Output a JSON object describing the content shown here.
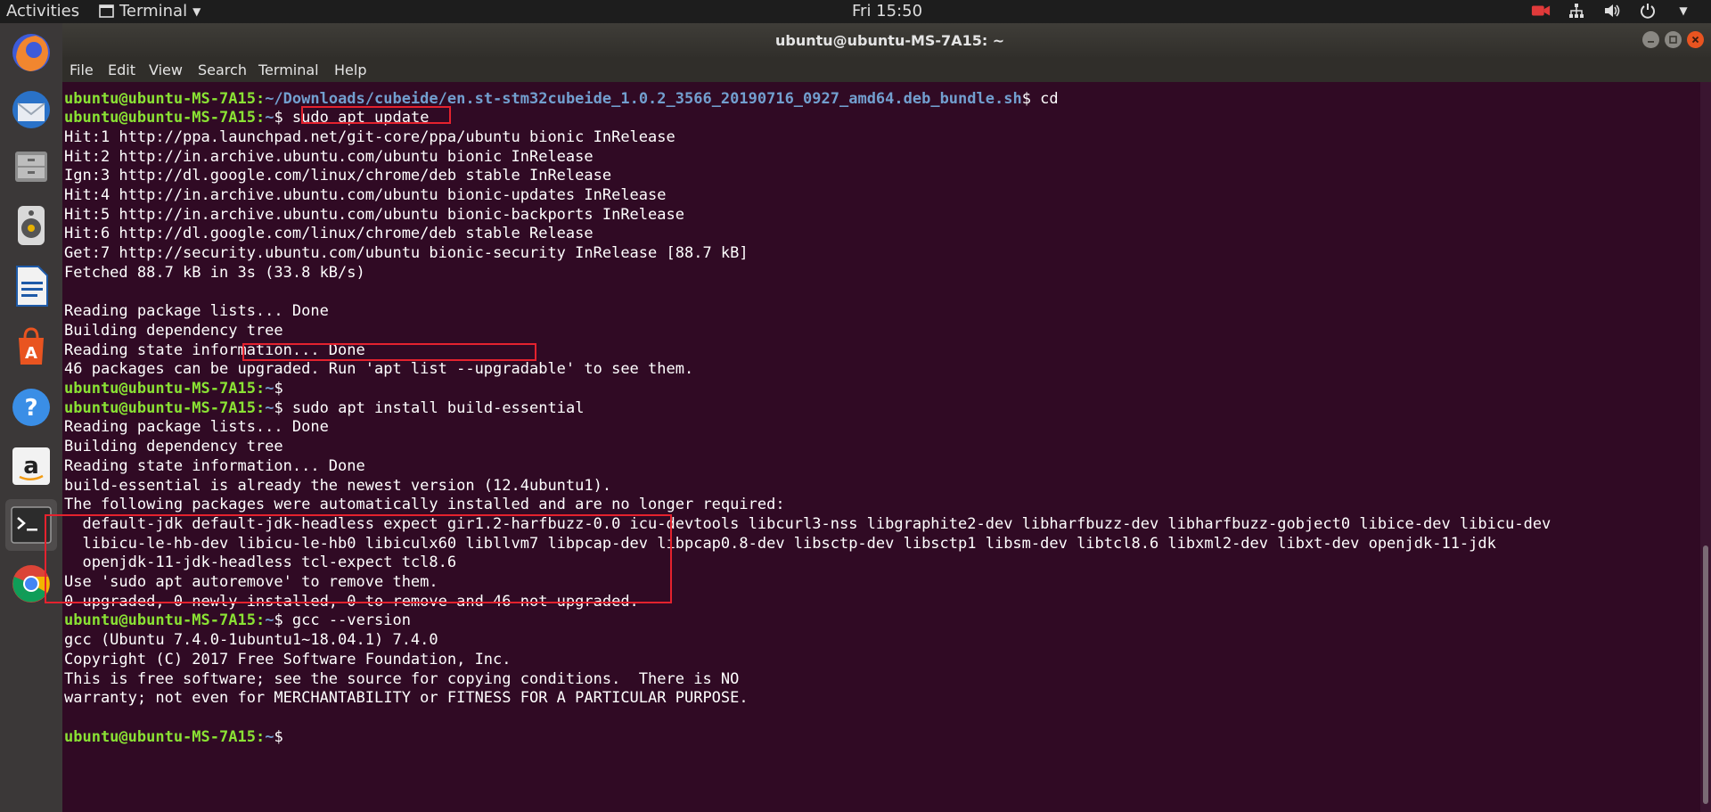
{
  "top_panel": {
    "activities": "Activities",
    "app_menu": "Terminal",
    "clock": "Fri 15:50"
  },
  "dock": {
    "items": [
      "firefox",
      "thunderbird",
      "files",
      "rhythmbox",
      "libreoffice-writer",
      "ubuntu-software",
      "help",
      "amazon",
      "terminal",
      "chrome"
    ]
  },
  "window": {
    "title": "ubuntu@ubuntu-MS-7A15: ~",
    "menu": [
      "File",
      "Edit",
      "View",
      "Search",
      "Terminal",
      "Help"
    ]
  },
  "terminal": {
    "lines": [
      {
        "prompt": "ubuntu@ubuntu-MS-7A15",
        "cwd": "~/Downloads/cubeide/en.st-stm32cubeide_1.0.2_3566_20190716_0927_amd64.deb_bundle.sh",
        "cmd": " cd"
      },
      {
        "prompt": "ubuntu@ubuntu-MS-7A15",
        "cwd": "~",
        "cmd": " sudo apt update"
      },
      {
        "text": "Hit:1 http://ppa.launchpad.net/git-core/ppa/ubuntu bionic InRelease"
      },
      {
        "text": "Hit:2 http://in.archive.ubuntu.com/ubuntu bionic InRelease"
      },
      {
        "text": "Ign:3 http://dl.google.com/linux/chrome/deb stable InRelease"
      },
      {
        "text": "Hit:4 http://in.archive.ubuntu.com/ubuntu bionic-updates InRelease"
      },
      {
        "text": "Hit:5 http://in.archive.ubuntu.com/ubuntu bionic-backports InRelease"
      },
      {
        "text": "Hit:6 http://dl.google.com/linux/chrome/deb stable Release"
      },
      {
        "text": "Get:7 http://security.ubuntu.com/ubuntu bionic-security InRelease [88.7 kB]"
      },
      {
        "text": "Fetched 88.7 kB in 3s (33.8 kB/s)"
      },
      {
        "text": ""
      },
      {
        "text": "Reading package lists... Done"
      },
      {
        "text": "Building dependency tree"
      },
      {
        "text": "Reading state information... Done"
      },
      {
        "text": "46 packages can be upgraded. Run 'apt list --upgradable' to see them."
      },
      {
        "prompt": "ubuntu@ubuntu-MS-7A15",
        "cwd": "~",
        "cmd": ""
      },
      {
        "prompt": "ubuntu@ubuntu-MS-7A15",
        "cwd": "~",
        "cmd": " sudo apt install build-essential"
      },
      {
        "text": "Reading package lists... Done"
      },
      {
        "text": "Building dependency tree"
      },
      {
        "text": "Reading state information... Done"
      },
      {
        "text": "build-essential is already the newest version (12.4ubuntu1)."
      },
      {
        "text": "The following packages were automatically installed and are no longer required:"
      },
      {
        "text": "  default-jdk default-jdk-headless expect gir1.2-harfbuzz-0.0 icu-devtools libcurl3-nss libgraphite2-dev libharfbuzz-dev libharfbuzz-gobject0 libice-dev libicu-dev"
      },
      {
        "text": "  libicu-le-hb-dev libicu-le-hb0 libiculx60 libllvm7 libpcap-dev libpcap0.8-dev libsctp-dev libsctp1 libsm-dev libtcl8.6 libxml2-dev libxt-dev openjdk-11-jdk"
      },
      {
        "text": "  openjdk-11-jdk-headless tcl-expect tcl8.6"
      },
      {
        "text": "Use 'sudo apt autoremove' to remove them."
      },
      {
        "text": "0 upgraded, 0 newly installed, 0 to remove and 46 not upgraded."
      },
      {
        "prompt": "ubuntu@ubuntu-MS-7A15",
        "cwd": "~",
        "cmd": " gcc --version"
      },
      {
        "text": "gcc (Ubuntu 7.4.0-1ubuntu1~18.04.1) 7.4.0"
      },
      {
        "text": "Copyright (C) 2017 Free Software Foundation, Inc."
      },
      {
        "text": "This is free software; see the source for copying conditions.  There is NO"
      },
      {
        "text": "warranty; not even for MERCHANTABILITY or FITNESS FOR A PARTICULAR PURPOSE."
      },
      {
        "text": ""
      },
      {
        "prompt": "ubuntu@ubuntu-MS-7A15",
        "cwd": "~",
        "cmd": ""
      }
    ]
  },
  "colors": {
    "terminal_bg": "#300a24",
    "prompt_user": "#8ae234",
    "prompt_cwd": "#729fcf",
    "highlight_box": "#e4222e"
  }
}
